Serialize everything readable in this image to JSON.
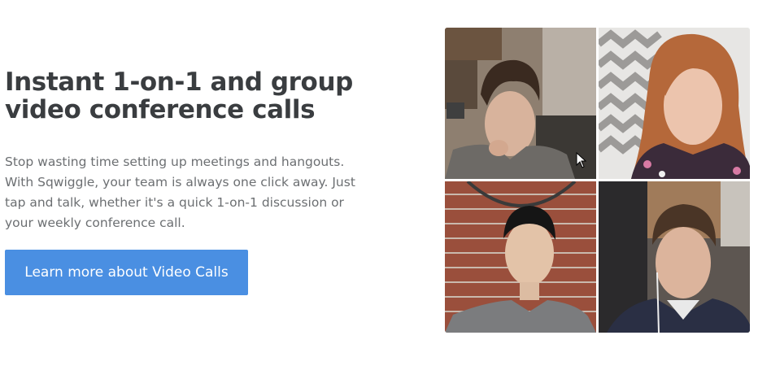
{
  "hero": {
    "headline": "Instant 1-on-1 and group video conference calls",
    "description": "Stop wasting time setting up meetings and hangouts. With Sqwiggle, your team is always one click away. Just tap and talk, whether it's a quick 1-on-1 discussion or your weekly conference call.",
    "cta_label": "Learn more about Video Calls"
  },
  "colors": {
    "headline": "#3a3d40",
    "body_text": "#6c6f72",
    "cta_background": "#4a8fe2",
    "cta_text": "#ffffff"
  },
  "video_grid": {
    "participants": [
      {
        "id": "participant-1"
      },
      {
        "id": "participant-2"
      },
      {
        "id": "participant-3"
      },
      {
        "id": "participant-4"
      }
    ]
  },
  "icons": {
    "cursor": "mouse-pointer-icon"
  }
}
